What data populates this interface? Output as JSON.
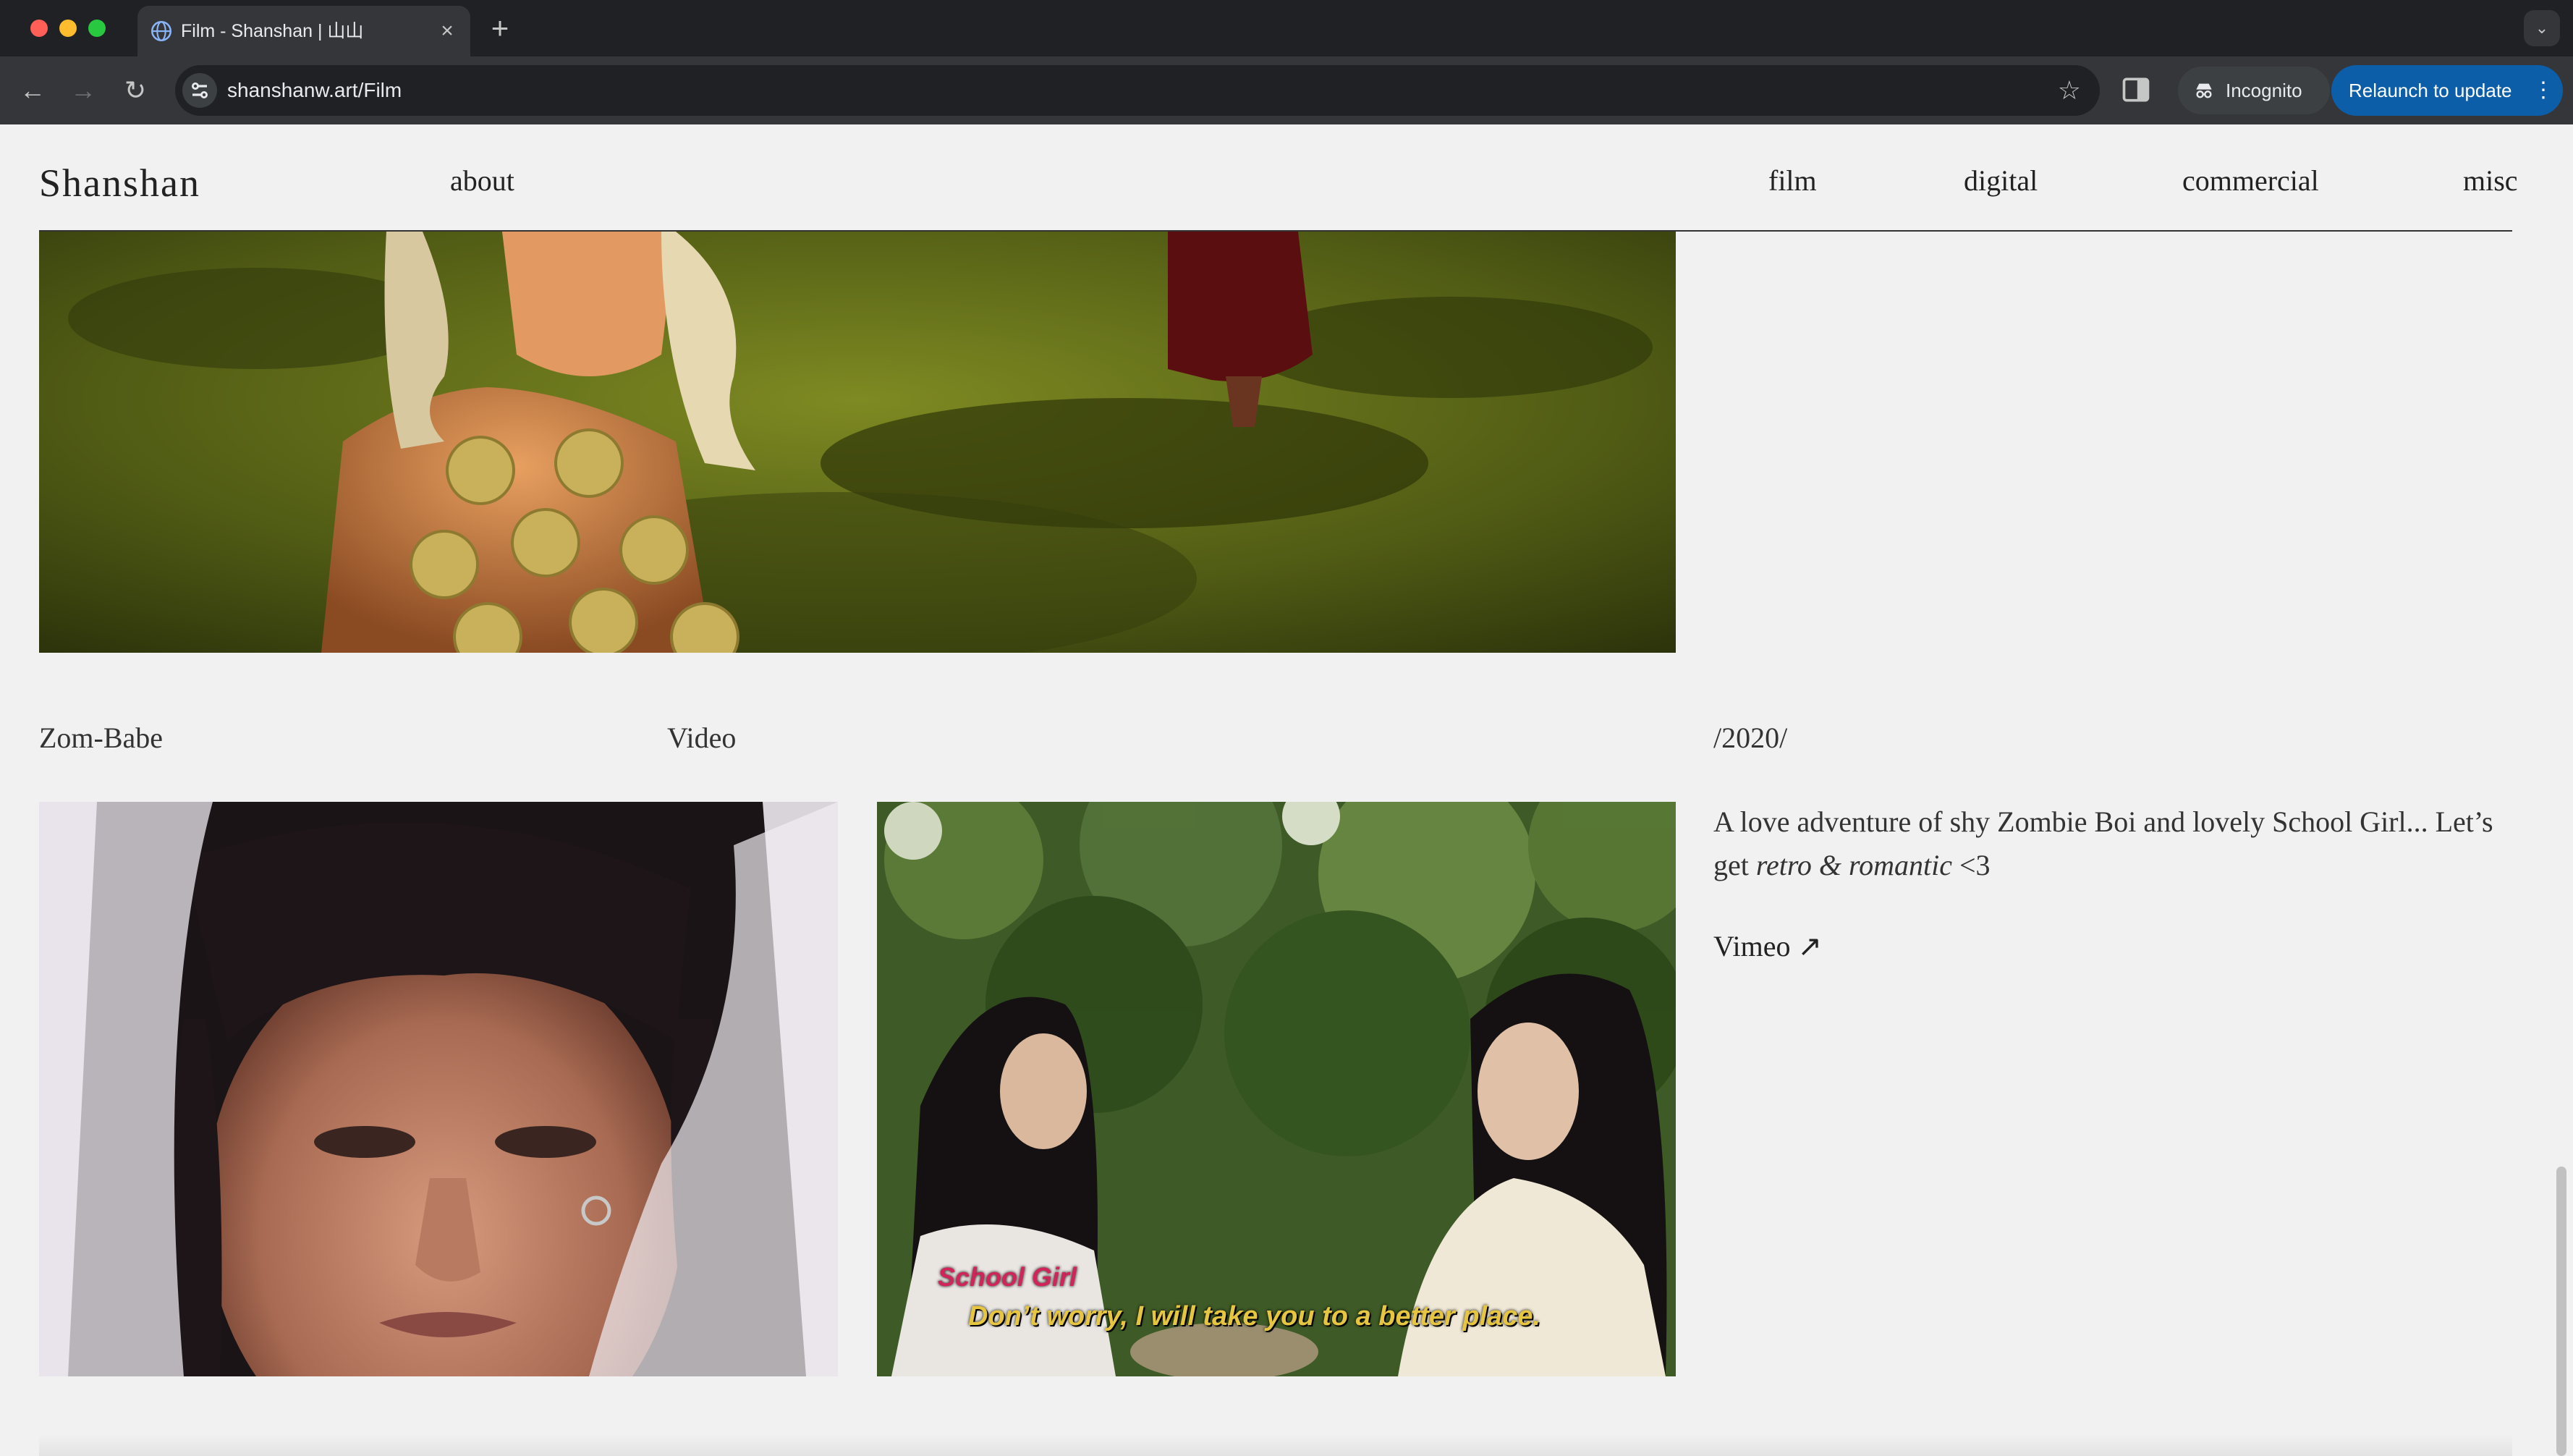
{
  "browser": {
    "tab_title": "Film - Shanshan | 山山",
    "tab_close": "×",
    "new_tab": "+",
    "tab_list": "⌄",
    "url": "shanshanw.art/Film",
    "incognito_label": "Incognito",
    "relaunch_label": "Relaunch to update",
    "back_icon": "←",
    "forward_icon": "→",
    "reload_icon": "↻",
    "star_icon": "☆",
    "menu_icon": "⋮"
  },
  "site": {
    "logo": "Shanshan",
    "nav_left": {
      "about": "about"
    },
    "nav_right": {
      "film": "film",
      "digital": "digital",
      "commercial": "commercial",
      "misc": "misc"
    }
  },
  "project": {
    "title": "Zom-Babe",
    "type": "Video",
    "year": "/2020/",
    "description_plain": "A love adventure of shy Zombie Boi and lovely School Girl... Let’s get",
    "description_italic": "retro & romantic",
    "description_end": " <3",
    "link_label": "Vimeo ↗"
  },
  "subtitles": {
    "speaker": "School Girl",
    "line": "Don’t worry, I will take you to a better place."
  },
  "colors": {
    "page_bg": "#f2f1f1",
    "text": "#222222",
    "chrome_dark": "#202124",
    "chrome_mid": "#35363a",
    "relaunch_blue": "#0d5ea8",
    "subtitle_speaker": "#d0245a",
    "subtitle_line": "#e6c640"
  }
}
